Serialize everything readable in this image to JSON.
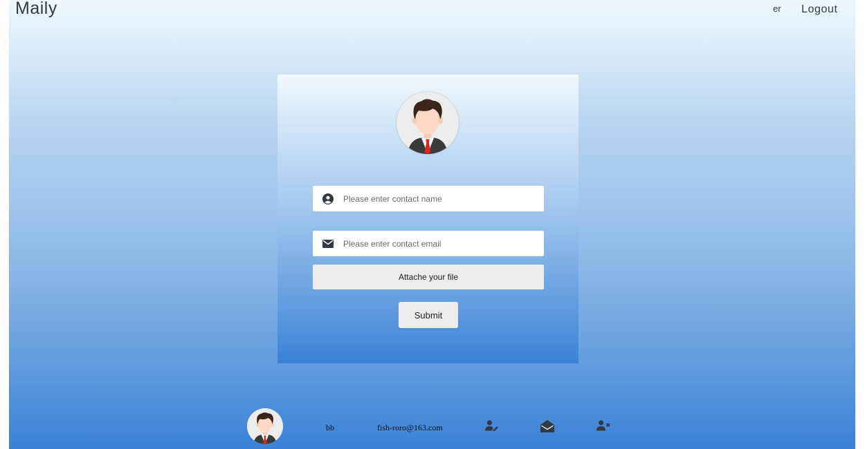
{
  "header": {
    "brand": "Maily",
    "user_short": "er",
    "logout_label": "Logout"
  },
  "form": {
    "name_placeholder": "Please enter contact name",
    "email_placeholder": "Please enter contact email",
    "attach_label": "Attache your file",
    "submit_label": "Submit"
  },
  "contacts": [
    {
      "name": "bb",
      "email": "fish-roro@163.com",
      "actions": [
        "user-edit-icon",
        "envelope-open-icon",
        "user-remove-icon"
      ]
    }
  ],
  "colors": {
    "accent": "#3a82d7",
    "text": "#333a45",
    "tie": "#e0231e"
  }
}
